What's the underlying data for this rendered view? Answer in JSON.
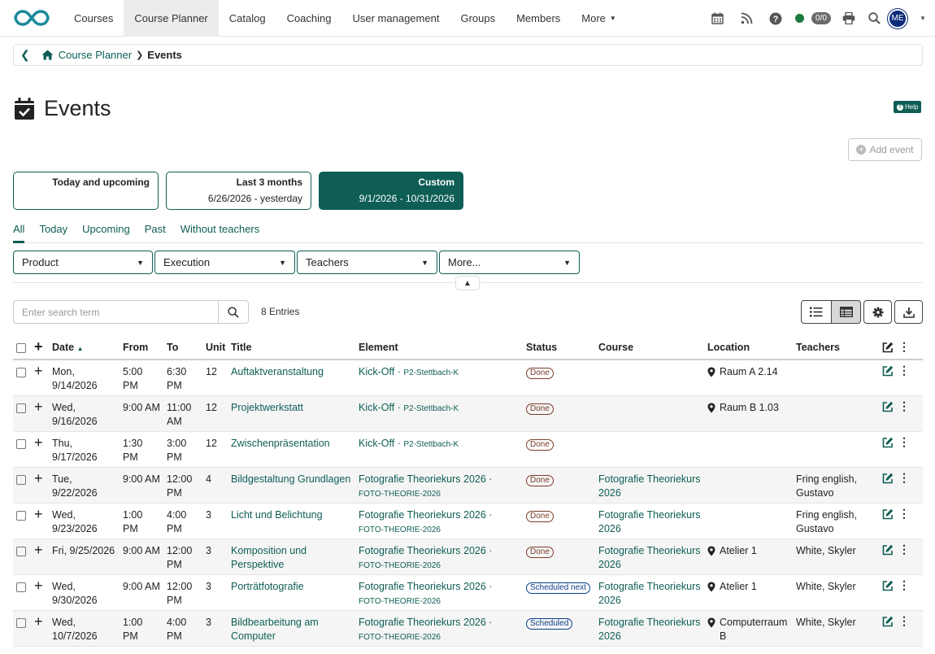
{
  "nav": {
    "items": [
      {
        "label": "Courses",
        "active": false
      },
      {
        "label": "Course Planner",
        "active": true
      },
      {
        "label": "Catalog",
        "active": false
      },
      {
        "label": "Coaching",
        "active": false
      },
      {
        "label": "User management",
        "active": false
      },
      {
        "label": "Groups",
        "active": false
      },
      {
        "label": "Members",
        "active": false
      }
    ],
    "more_label": "More",
    "count_badge": "0/0",
    "avatar_initials": "ME",
    "online_color": "#1a7a3e"
  },
  "breadcrumb": {
    "parent": "Course Planner",
    "current": "Events"
  },
  "page": {
    "title": "Events",
    "help_label": "Help",
    "add_event_label": "Add event"
  },
  "ranges": [
    {
      "title": "Today and upcoming",
      "sub": "",
      "selected": false
    },
    {
      "title": "Last 3 months",
      "sub": "6/26/2026 - yesterday",
      "selected": false
    },
    {
      "title": "Custom",
      "sub": "9/1/2026 - 10/31/2026",
      "selected": true
    }
  ],
  "tabs": [
    "All",
    "Today",
    "Upcoming",
    "Past",
    "Without teachers"
  ],
  "filters": [
    "Product",
    "Execution",
    "Teachers",
    "More..."
  ],
  "search": {
    "placeholder": "Enter search term",
    "entries": "8 Entries"
  },
  "columns": {
    "date": "Date",
    "from": "From",
    "to": "To",
    "unit": "Unit",
    "title": "Title",
    "element": "Element",
    "status": "Status",
    "course": "Course",
    "location": "Location",
    "teachers": "Teachers"
  },
  "rows": [
    {
      "date": "Mon, 9/14/2026",
      "from": "5:00 PM",
      "to": "6:30 PM",
      "unit": "12",
      "title": "Auftaktveranstaltung",
      "element": "Kick-Off",
      "code": "P2-Stettbach-K",
      "status": "Done",
      "course": "",
      "location": "Raum A 2.14",
      "teachers": ""
    },
    {
      "date": "Wed, 9/16/2026",
      "from": "9:00 AM",
      "to": "11:00 AM",
      "unit": "12",
      "title": "Projektwerkstatt",
      "element": "Kick-Off",
      "code": "P2-Stettbach-K",
      "status": "Done",
      "course": "",
      "location": "Raum B 1.03",
      "teachers": ""
    },
    {
      "date": "Thu, 9/17/2026",
      "from": "1:30 PM",
      "to": "3:00 PM",
      "unit": "12",
      "title": "Zwischenpräsentation",
      "element": "Kick-Off",
      "code": "P2-Stettbach-K",
      "status": "Done",
      "course": "",
      "location": "",
      "teachers": ""
    },
    {
      "date": "Tue, 9/22/2026",
      "from": "9:00 AM",
      "to": "12:00 PM",
      "unit": "4",
      "title": "Bildgestaltung Grundlagen",
      "element": "Fotografie Theoriekurs 2026",
      "code": "FOTO-THEORIE-2026",
      "status": "Done",
      "course": "Fotografie Theoriekurs 2026",
      "location": "",
      "teachers": "Fring english, Gustavo"
    },
    {
      "date": "Wed, 9/23/2026",
      "from": "1:00 PM",
      "to": "4:00 PM",
      "unit": "3",
      "title": "Licht und Belichtung",
      "element": "Fotografie Theoriekurs 2026",
      "code": "FOTO-THEORIE-2026",
      "status": "Done",
      "course": "Fotografie Theoriekurs 2026",
      "location": "",
      "teachers": "Fring english, Gustavo"
    },
    {
      "date": "Fri, 9/25/2026",
      "from": "9:00 AM",
      "to": "12:00 PM",
      "unit": "3",
      "title": "Komposition und Perspektive",
      "element": "Fotografie Theoriekurs 2026",
      "code": "FOTO-THEORIE-2026",
      "status": "Done",
      "course": "Fotografie Theoriekurs 2026",
      "location": "Atelier 1",
      "teachers": "White, Skyler"
    },
    {
      "date": "Wed, 9/30/2026",
      "from": "9:00 AM",
      "to": "12:00 PM",
      "unit": "3",
      "title": "Porträtfotografie",
      "element": "Fotografie Theoriekurs 2026",
      "code": "FOTO-THEORIE-2026",
      "status": "Scheduled next",
      "course": "Fotografie Theoriekurs 2026",
      "location": "Atelier 1",
      "teachers": "White, Skyler"
    },
    {
      "date": "Wed, 10/7/2026",
      "from": "1:00 PM",
      "to": "4:00 PM",
      "unit": "3",
      "title": "Bildbearbeitung am Computer",
      "element": "Fotografie Theoriekurs 2026",
      "code": "FOTO-THEORIE-2026",
      "status": "Scheduled",
      "course": "Fotografie Theoriekurs 2026",
      "location": "Computerraum B",
      "teachers": "White, Skyler"
    }
  ],
  "colors": {
    "accent": "#0e5e55",
    "done": "#7a3c2b",
    "scheduled": "#0b3e8a"
  },
  "icons": [
    "calendar-check-icon",
    "calendar-icon",
    "rss-icon",
    "help-circle-icon",
    "print-icon",
    "search-icon",
    "home-icon",
    "map-pin-icon",
    "edit-icon",
    "list-icon",
    "table-icon",
    "gear-icon",
    "download-icon"
  ]
}
